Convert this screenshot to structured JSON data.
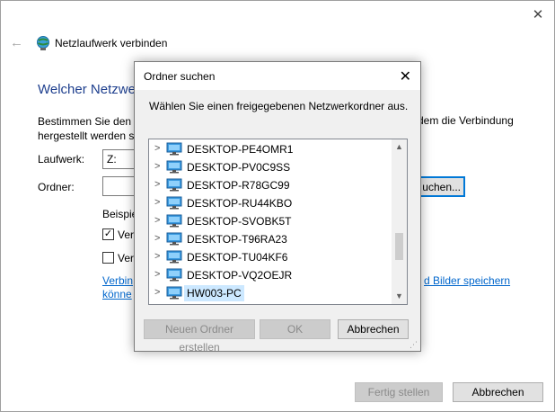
{
  "wizard": {
    "title": "Netzlaufwerk verbinden",
    "heading": "Welcher Netzwe",
    "description_line1": "Bestimmen Sie den L",
    "description_line2": "hergestellt werden so",
    "description_right": "dem die Verbindung",
    "drive_label": "Laufwerk:",
    "drive_value": "Z:",
    "folder_label": "Ordner:",
    "browse_label": "uchen...",
    "example_label": "Beispie",
    "checkbox1_label": "Verb",
    "checkbox2_label": "Verb",
    "link_line1": "Verbin",
    "link_line2": "könne",
    "link_right": "d Bilder speichern",
    "finish_label": "Fertig stellen",
    "cancel_label": "Abbrechen"
  },
  "dialog": {
    "title": "Ordner suchen",
    "instruction": "Wählen Sie einen freigegebenen Netzwerkordner aus.",
    "items": [
      {
        "label": "DESKTOP-PE4OMR1"
      },
      {
        "label": "DESKTOP-PV0C9SS"
      },
      {
        "label": "DESKTOP-R78GC99"
      },
      {
        "label": "DESKTOP-RU44KBO"
      },
      {
        "label": "DESKTOP-SVOBK5T"
      },
      {
        "label": "DESKTOP-T96RA23"
      },
      {
        "label": "DESKTOP-TU04KF6"
      },
      {
        "label": "DESKTOP-VQ2OEJR"
      },
      {
        "label": "HW003-PC"
      }
    ],
    "new_folder_label": "Neuen Ordner erstellen",
    "ok_label": "OK",
    "cancel_label": "Abbrechen"
  },
  "colors": {
    "heading": "#1e3f8e",
    "link": "#0066cc",
    "selection": "#cce8ff"
  }
}
